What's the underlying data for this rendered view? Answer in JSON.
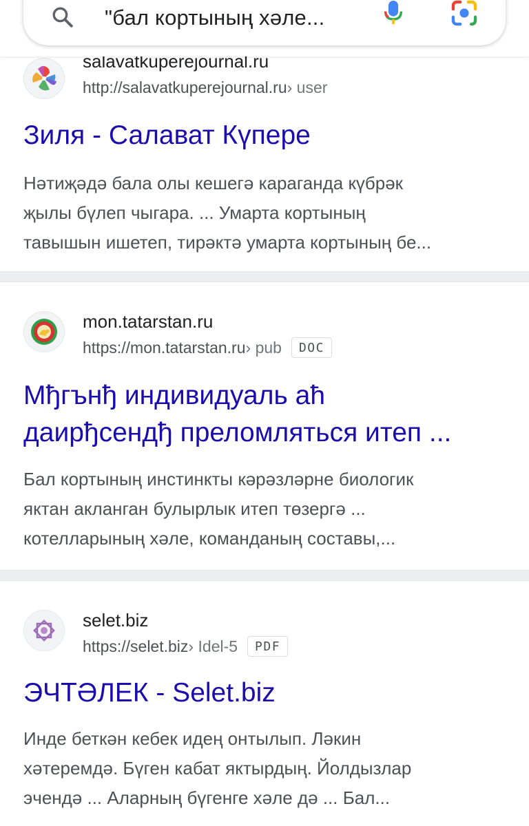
{
  "search": {
    "query": "\"бал кортының хәле..."
  },
  "results": [
    {
      "site_name": "salavatkuperejournal.ru",
      "url_base": "http://salavatkuperejournal.ru",
      "url_path": " › user",
      "title_lines": [
        "Зиля - Салават Күпере"
      ],
      "snippet_lines": [
        "Нәтиҗәдә бала олы кешегә караганда күбрәк",
        "җылы бүлеп чыгара. ... Умарта кортының",
        "тавышын ишетеп, тирәктә умарта кортының бе..."
      ]
    },
    {
      "site_name": "mon.tatarstan.ru",
      "url_base": "https://mon.tatarstan.ru",
      "url_path": " › pub",
      "badge": "DOC",
      "title_lines": [
        "Мђгънђ индивидуаль аћ",
        "даирђсендђ преломляться итеп ..."
      ],
      "snippet_lines": [
        "Бал кортының инстинкты кәрәзләрне биологик",
        "яктан акланган булырлык итеп төзергә ...",
        "котелларының хәле, команданың составы,..."
      ]
    },
    {
      "site_name": "selet.biz",
      "url_base": "https://selet.biz",
      "url_path": " › Idel-5",
      "badge": "PDF",
      "title_lines": [
        "ЭЧТӘЛЕК - Selet.biz"
      ],
      "snippet_lines": [
        "Инде беткән кебек идең онтылып. Ләкин",
        "хәтеремдә. Бүген кабат яктырдың. Йолдызлар",
        "эчендә ... Аларның бүгенге хәле дә ... Бал..."
      ]
    }
  ],
  "colors": {
    "link": "#1a0dab",
    "divider": "#eceff1"
  }
}
